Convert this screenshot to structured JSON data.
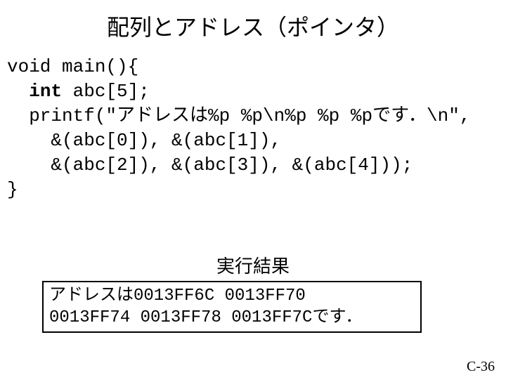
{
  "title": "配列とアドレス（ポインタ）",
  "code": {
    "l1a": "void main(){",
    "l2a": "  ",
    "l2kw": "int",
    "l2b": " abc[5];",
    "l3": "  printf(\"アドレスは%p %p\\n%p %p %pです．\\n\",",
    "l4": "    &(abc[0]), &(abc[1]),",
    "l5": "    &(abc[2]), &(abc[3]), &(abc[4]));",
    "l6": "}"
  },
  "result_label": "実行結果",
  "result_text": "アドレスは0013FF6C 0013FF70\n0013FF74 0013FF78 0013FF7Cです．",
  "page_number": "C-36"
}
